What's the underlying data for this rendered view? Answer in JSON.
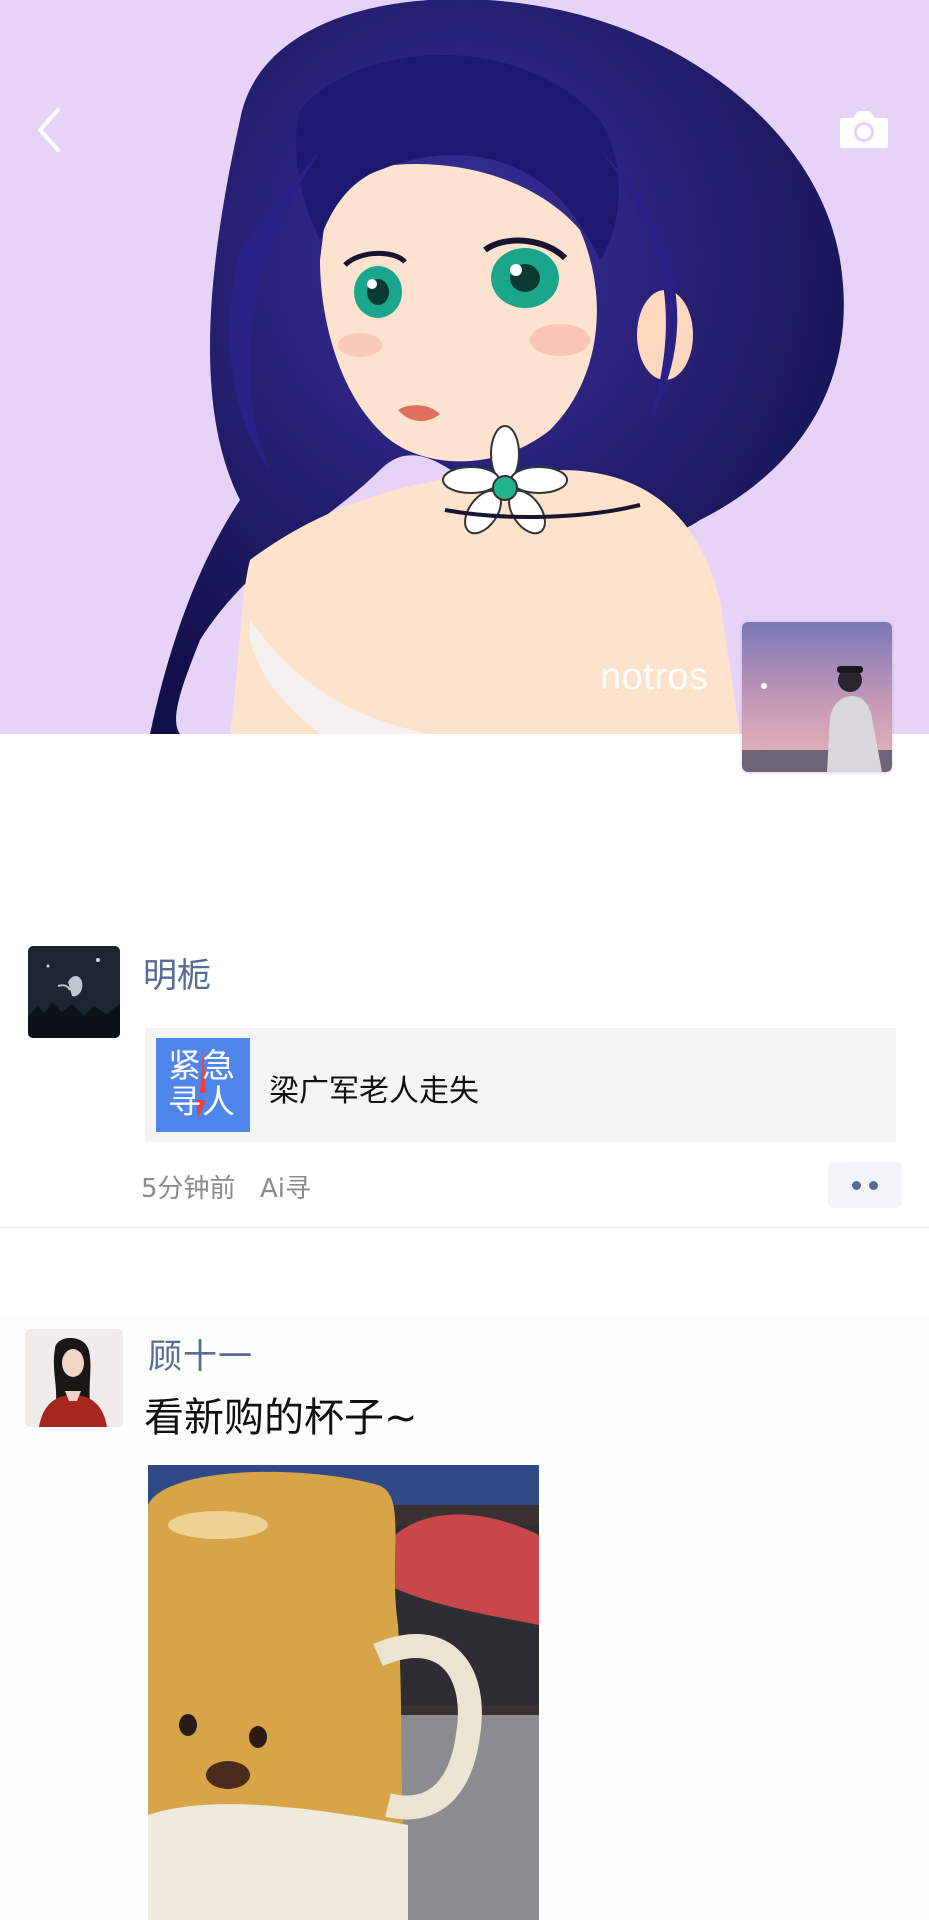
{
  "header": {
    "back_icon": "chevron-left-icon",
    "camera_icon": "camera-icon",
    "cover_name": "notros",
    "cover_image": "anime girl illustration cover",
    "profile_avatar": "silhouette at dusk avatar"
  },
  "posts": [
    {
      "author": "明栀",
      "avatar": "night scene avatar",
      "share_card": {
        "thumb_line1": "紧急",
        "thumb_line2": "寻人",
        "title": "梁广军老人走失"
      },
      "time": "5分钟前",
      "source": "Ai寻",
      "more_icon": "more-dots-icon"
    },
    {
      "author": "顾十一",
      "avatar": "woman portrait avatar",
      "text": "看新购的杯子~",
      "photo": "bear-shaped mug photo"
    }
  ],
  "colors": {
    "cover_bg": "#e6d1f7",
    "name_blue": "#576b95",
    "card_bg": "#f4f4f4",
    "thumb_blue": "#4f86ec",
    "meta_gray": "#8a8a8a"
  }
}
